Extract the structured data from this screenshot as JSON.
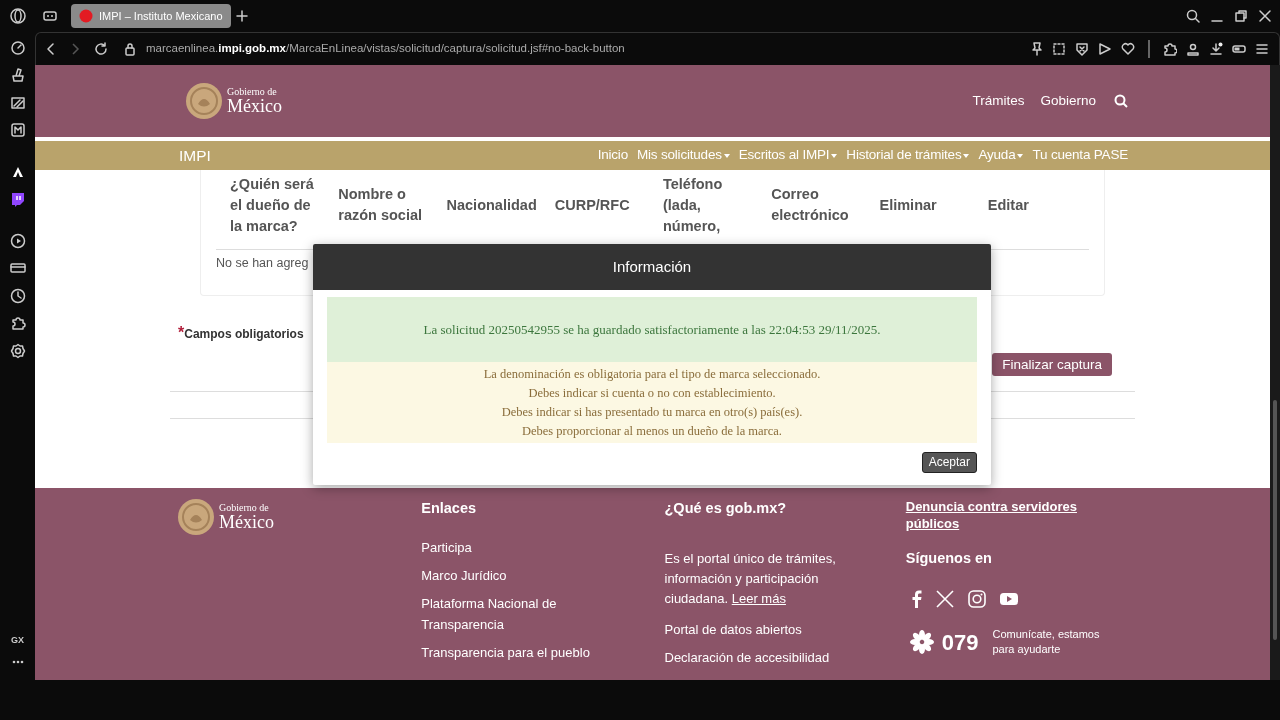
{
  "browser": {
    "tab_title": "IMPI – Instituto Mexicano",
    "url": "marcaenlinea.**impi.gob.mx**/MarcaEnLinea/vistas/solicitud/captura/solicitud.jsf#no-back-button",
    "sidebar_label": "GX"
  },
  "header": {
    "logo": {
      "line_1": "Gobierno de",
      "line_2": "México"
    },
    "links": [
      "Trámites",
      "Gobierno"
    ]
  },
  "subnav": {
    "brand": "IMPI",
    "items": [
      {
        "label": "Inicio",
        "dropdown": false
      },
      {
        "label": "Mis solicitudes",
        "dropdown": true
      },
      {
        "label": "Escritos al IMPI",
        "dropdown": true
      },
      {
        "label": "Historial de trámites",
        "dropdown": true
      },
      {
        "label": "Ayuda",
        "dropdown": true
      },
      {
        "label": "Tu cuenta PASE",
        "dropdown": false
      }
    ]
  },
  "owners_table": {
    "columns": [
      "¿Quién será el dueño de la marca?",
      "Nombre o razón social",
      "Nacionalidad",
      "CURP/RFC",
      "Teléfono (lada, número,",
      "Correo electrónico",
      "Eliminar",
      "Editar"
    ],
    "empty_message": "No se han agreg"
  },
  "required_note": {
    "mark": "*",
    "label": "Campos obligatorios"
  },
  "finish_button": "Finalizar captura",
  "modal": {
    "title": "Información",
    "success": "La solicitud 20250542955 se ha guardado satisfactoriamente a las 22:04:53 29/11/2025.",
    "warnings": [
      "La denominación es obligatoria para el tipo de marca seleccionado.",
      "Debes indicar si cuenta o no con establecimiento.",
      "Debes indicar si has presentado tu marca en otro(s) país(es).",
      "Debes proporcionar al menos un dueño de la marca."
    ],
    "button": "Aceptar"
  },
  "footer": {
    "logo": {
      "line_1": "Gobierno de",
      "line_2": "México"
    },
    "links": {
      "title": "Enlaces",
      "items": [
        "Participa",
        "Marco Jurídico",
        "Plataforma Nacional de Transparencia",
        "Transparencia para el pueblo"
      ]
    },
    "about": {
      "title": "¿Qué es gob.mx?",
      "text": "Es el portal único de trámites, información y participación ciudadana.",
      "read_more": "Leer más",
      "items": [
        "Portal de datos abiertos",
        "Declaración de accesibilidad"
      ]
    },
    "report_link": "Denuncia contra servidores públicos",
    "follow": "Síguenos en",
    "phone": {
      "number": "079",
      "text": "Comunícate, estamos para ayudarte"
    }
  }
}
